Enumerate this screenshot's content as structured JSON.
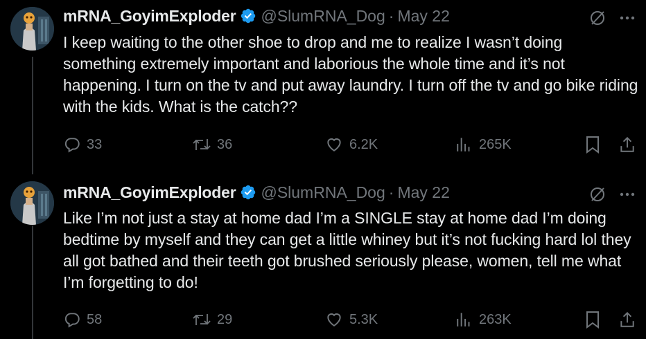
{
  "tweets": [
    {
      "display_name": "mRNA_GoyimExploder",
      "handle": "@SlumRNA_Dog",
      "separator": "·",
      "date": "May 22",
      "text": "I keep waiting to the other shoe to drop and me to realize I wasn’t doing something extremely important and laborious the whole time and it’s not happening. I turn on the tv and put away laundry. I turn off the tv and go bike riding with the kids. What is the catch??",
      "replies": "33",
      "retweets": "36",
      "likes": "6.2K",
      "views": "265K"
    },
    {
      "display_name": "mRNA_GoyimExploder",
      "handle": "@SlumRNA_Dog",
      "separator": "·",
      "date": "May 22",
      "text": "Like I’m not just a stay at home dad I’m a SINGLE stay at home dad I’m doing bedtime by myself and they can get a little whiney but it’s not fucking hard lol they all got bathed and their teeth got brushed seriously please, women, tell me what I’m forgetting to do!",
      "replies": "58",
      "retweets": "29",
      "likes": "5.3K",
      "views": "263K"
    }
  ],
  "colors": {
    "background": "#000000",
    "text": "#e7e9ea",
    "muted": "#71767b",
    "verified": "#1d9bf0",
    "thread_line": "#333639"
  },
  "icons": [
    "verified-badge-icon",
    "grok-icon",
    "more-icon",
    "reply-icon",
    "retweet-icon",
    "like-icon",
    "views-icon",
    "bookmark-icon",
    "share-icon"
  ]
}
